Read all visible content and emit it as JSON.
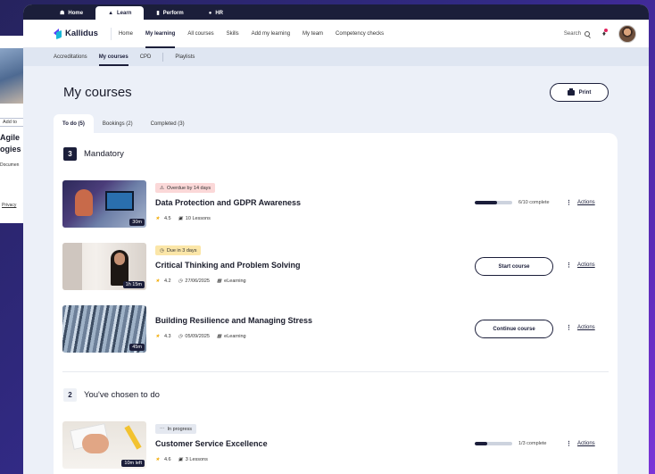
{
  "background_card": {
    "add_to": "Add to",
    "title_line1": "Agile",
    "title_line2": "ogies",
    "document": "Documen",
    "privacy": "Privacy"
  },
  "top_tabs": [
    {
      "label": "Home",
      "icon": "home-icon"
    },
    {
      "label": "Learn",
      "icon": "graduation-cap-icon",
      "active": true
    },
    {
      "label": "Perform",
      "icon": "bar-chart-icon"
    },
    {
      "label": "HR",
      "icon": "chat-icon"
    }
  ],
  "brand": {
    "name": "Kallidus",
    "colors": {
      "mark_primary": "#5b3ff5",
      "mark_secondary": "#19b7d8",
      "navy": "#1b1e3a"
    }
  },
  "main_nav": {
    "items": [
      "Home",
      "My learning",
      "All courses",
      "Skills",
      "Add my learning",
      "My team",
      "Competency checks"
    ],
    "active": "My learning",
    "search_label": "Search"
  },
  "sub_nav": {
    "items": [
      "Accreditations",
      "My courses",
      "CPD",
      "Playlists"
    ],
    "active": "My courses"
  },
  "page": {
    "title": "My courses",
    "print_label": "Print",
    "tabs": [
      {
        "label": "To do (5)",
        "active": true
      },
      {
        "label": "Bookings (2)"
      },
      {
        "label": "Completed (3)"
      }
    ]
  },
  "sections": [
    {
      "count": "3",
      "title": "Mandatory"
    },
    {
      "count": "2",
      "title": "You've chosen to do"
    }
  ],
  "courses": [
    {
      "badge": "Overdue by 14 days",
      "badge_icon": "warning-icon",
      "badge_color": "#fbd8d8",
      "title": "Data Protection and GDPR Awareness",
      "rating": "4.5",
      "detail": "10 Lessons",
      "detail_icon": "stack-icon",
      "duration": "30m",
      "progress_text": "6/10 complete",
      "progress_fraction": 0.6,
      "actions_label": "Actions"
    },
    {
      "badge": "Due in 3 days",
      "badge_icon": "clock-icon",
      "badge_color": "#fbe6a8",
      "title": "Critical Thinking and Problem Solving",
      "rating": "4.2",
      "date": "27/06/2025",
      "type": "eLearning",
      "duration": "1h 15m",
      "button": "Start course",
      "actions_label": "Actions"
    },
    {
      "title": "Building Resilience and Managing Stress",
      "rating": "4.3",
      "date": "05/09/2025",
      "type": "eLearning",
      "duration": "45m",
      "button": "Continue course",
      "actions_label": "Actions"
    },
    {
      "badge": "In progress",
      "badge_icon": "ellipsis-icon",
      "badge_color": "#e4e8f0",
      "title": "Customer Service Excellence",
      "rating": "4.6",
      "detail": "3 Lessons",
      "detail_icon": "stack-icon",
      "duration": "10m left",
      "progress_text": "1/3 complete",
      "progress_fraction": 0.33,
      "actions_label": "Actions"
    }
  ]
}
